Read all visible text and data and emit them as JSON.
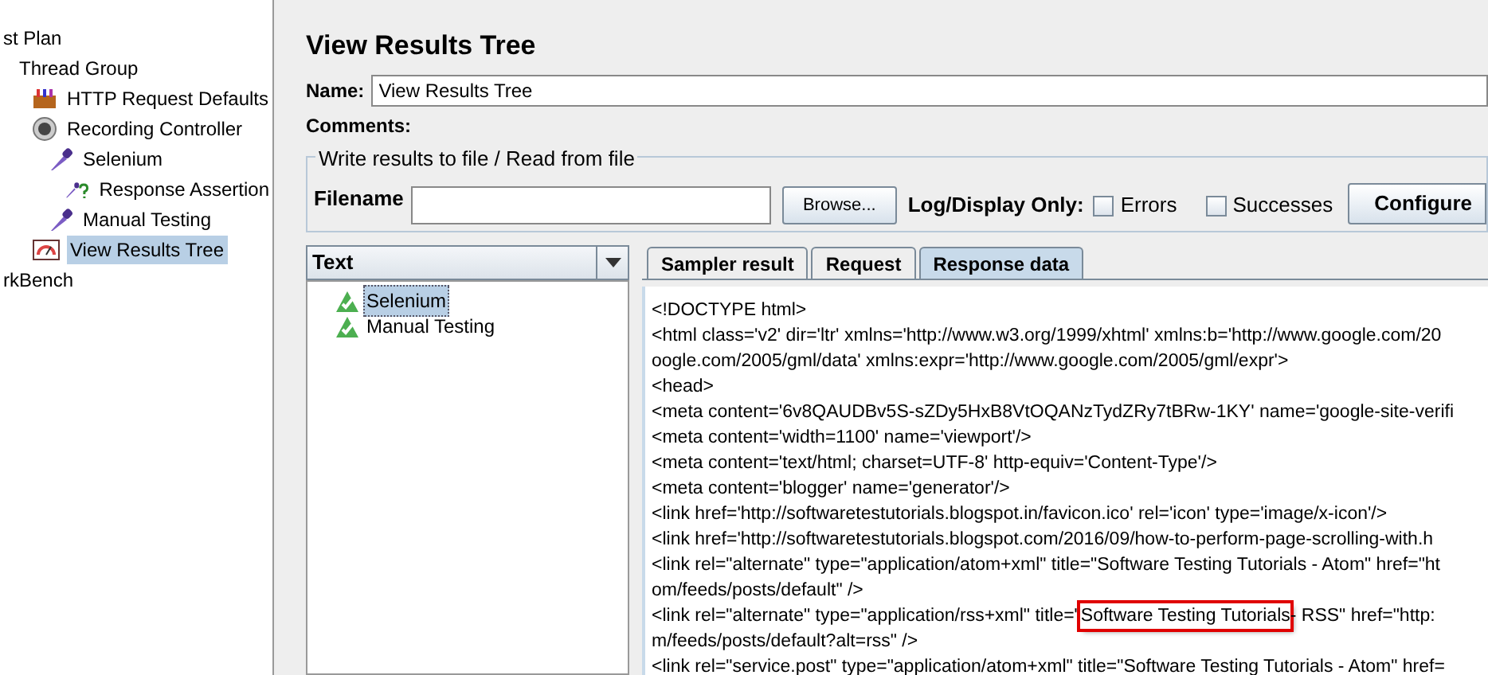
{
  "tree": [
    {
      "label": "st Plan",
      "selected": false,
      "children": [
        {
          "label": "Thread Group",
          "selected": false,
          "children": [
            {
              "label": "HTTP Request Defaults",
              "kind": "config",
              "selected": false
            },
            {
              "label": "Recording Controller",
              "kind": "controller",
              "selected": false,
              "children": [
                {
                  "label": "Selenium",
                  "kind": "sampler",
                  "selected": false,
                  "children": [
                    {
                      "label": "Response Assertion",
                      "kind": "assertion",
                      "selected": false
                    }
                  ]
                },
                {
                  "label": "Manual Testing",
                  "kind": "sampler",
                  "selected": false
                }
              ]
            },
            {
              "label": "View Results Tree",
              "kind": "listener",
              "selected": true
            }
          ]
        }
      ]
    },
    {
      "label": "rkBench",
      "selected": false
    }
  ],
  "title": "View Results Tree",
  "name": {
    "label": "Name:",
    "value": "View Results Tree"
  },
  "comments": {
    "label": "Comments:"
  },
  "file_group": {
    "legend": "Write results to file / Read from file",
    "filename_label": "Filename",
    "browse": "Browse...",
    "log_label": "Log/Display Only:",
    "errors": {
      "label": "Errors",
      "checked": false
    },
    "successes": {
      "label": "Successes",
      "checked": false
    },
    "configure": "Configure"
  },
  "renderer": {
    "value": "Text"
  },
  "results": [
    {
      "label": "Selenium",
      "selected": true
    },
    {
      "label": "Manual Testing",
      "selected": false
    }
  ],
  "tabs": [
    {
      "label": "Sampler result",
      "selected": false
    },
    {
      "label": "Request",
      "selected": false
    },
    {
      "label": "Response data",
      "selected": true
    }
  ],
  "response_lines": [
    {
      "kind": "plain",
      "text": "<!DOCTYPE html>"
    },
    {
      "kind": "plain",
      "text": "<html class='v2' dir='ltr' xmlns='http://www.w3.org/1999/xhtml' xmlns:b='http://www.google.com/20"
    },
    {
      "kind": "plain",
      "text": "oogle.com/2005/gml/data' xmlns:expr='http://www.google.com/2005/gml/expr'>"
    },
    {
      "kind": "plain",
      "text": "<head>"
    },
    {
      "kind": "plain",
      "text": "<meta content='6v8QAUDBv5S-sZDy5HxB8VtOQANzTydZRy7tBRw-1KY' name='google-site-verifi"
    },
    {
      "kind": "plain",
      "text": "<meta content='width=1100' name='viewport'/>"
    },
    {
      "kind": "plain",
      "text": "<meta content='text/html; charset=UTF-8' http-equiv='Content-Type'/>"
    },
    {
      "kind": "plain",
      "text": "<meta content='blogger' name='generator'/>"
    },
    {
      "kind": "plain",
      "text": "<link href='http://softwaretestutorials.blogspot.in/favicon.ico' rel='icon' type='image/x-icon'/>"
    },
    {
      "kind": "plain",
      "text": "<link href='http://softwaretestutorials.blogspot.com/2016/09/how-to-perform-page-scrolling-with.h"
    },
    {
      "kind": "plain",
      "text": "<link rel=\"alternate\" type=\"application/atom+xml\" title=\"Software Testing Tutorials - Atom\" href=\"ht"
    },
    {
      "kind": "plain",
      "text": "om/feeds/posts/default\" />"
    },
    {
      "kind": "boxed",
      "before": "<link rel=\"alternate\" type=\"application/rss+xml\" title=\"",
      "boxed": "Software Testing Tutorials",
      "after": " - RSS\" href=\"http:"
    },
    {
      "kind": "plain",
      "text": "m/feeds/posts/default?alt=rss\" />"
    },
    {
      "kind": "plain",
      "text": "<link rel=\"service.post\" type=\"application/atom+xml\" title=\"Software Testing Tutorials - Atom\" href="
    }
  ]
}
